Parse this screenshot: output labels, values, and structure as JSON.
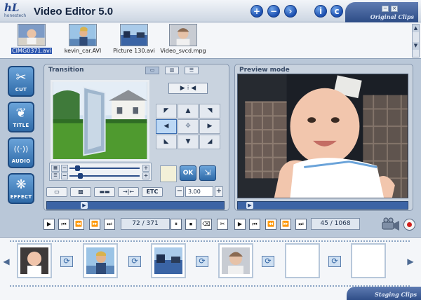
{
  "app": {
    "logo_text": "hL",
    "logo_sub": "honestech",
    "title": "Video Editor 5.0",
    "top_buttons": [
      "+",
      "−",
      "›",
      "i",
      "c"
    ],
    "window_buttons": [
      "−",
      "×"
    ],
    "original_clips_label": "Original Clips"
  },
  "clips": [
    {
      "name": "CIMG0371.avi",
      "selected": true
    },
    {
      "name": "kevin_car.AVI",
      "selected": false
    },
    {
      "name": "Picture 130.avi",
      "selected": false
    },
    {
      "name": "Video_svcd.mpg",
      "selected": false
    }
  ],
  "tools": [
    {
      "label": "CUT",
      "icon": "scissors-icon",
      "glyph": "✂"
    },
    {
      "label": "TITLE",
      "icon": "leaf-icon",
      "glyph": "❦"
    },
    {
      "label": "AUDIO",
      "icon": "sound-wave-icon",
      "glyph": "((·))"
    },
    {
      "label": "EFFECT",
      "icon": "effect-swirl-icon",
      "glyph": "❋"
    }
  ],
  "transition": {
    "title": "Transition",
    "view_buttons": [
      "▭",
      "▥",
      "☰"
    ],
    "direction_top": "▶ ⁝ ◀",
    "direction_grid": [
      "◤",
      "▲",
      "◥",
      "◀",
      "✥",
      "▶",
      "◣",
      "▼",
      "◢"
    ],
    "selected_direction": "◀",
    "ok_label": "OK",
    "apply_glyph": "⇲",
    "fx_buttons": [
      "▭",
      "▩",
      "▬▬",
      "→|←",
      "ETC"
    ],
    "duration_minus": "−",
    "duration_value": "3.00",
    "duration_plus": "+",
    "slider_values": [
      0.08,
      0.12
    ]
  },
  "preview": {
    "title": "Preview mode"
  },
  "transport": {
    "left_buttons": [
      "▶",
      "⏮",
      "⏪",
      "⏩",
      "⏭"
    ],
    "left_counter": "72 / 371",
    "mid_buttons": [
      "⏸",
      "⏹",
      "⌫",
      "✂"
    ],
    "right_buttons": [
      "▶",
      "⏮",
      "⏪",
      "⏩",
      "⏭"
    ],
    "right_counter": "45 / 1068"
  },
  "staging": {
    "label": "Staging Clips",
    "left_arrow": "◀",
    "right_arrow": "▶",
    "transition_glyph": "⟳"
  },
  "colors": {
    "accent": "#2e6aa8",
    "panel": "#c9d3df",
    "selection": "#2c56b0"
  }
}
